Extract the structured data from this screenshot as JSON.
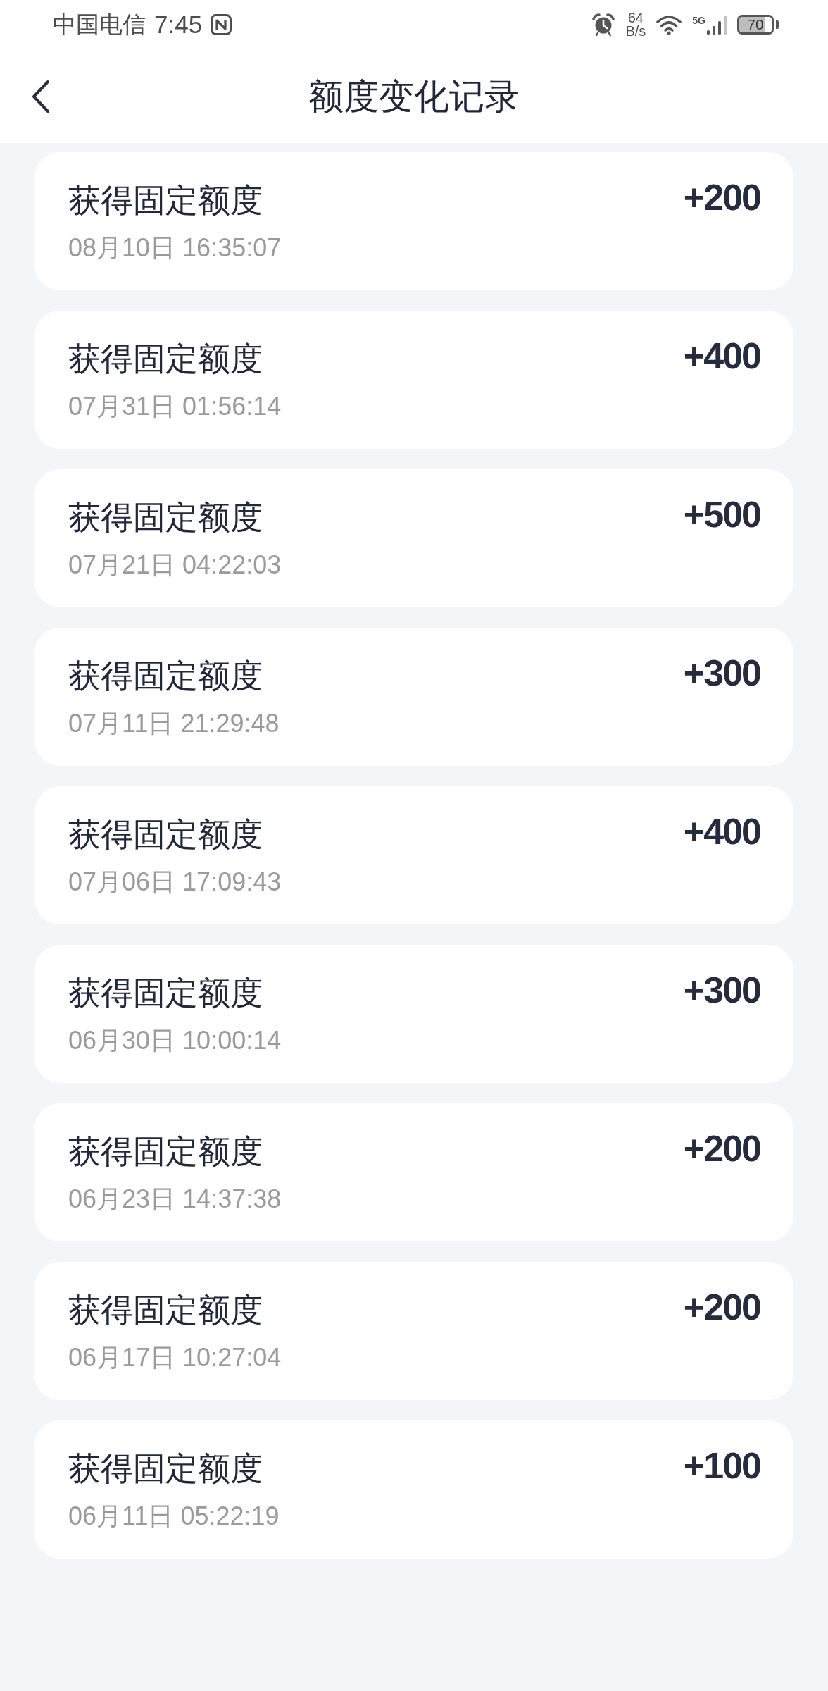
{
  "status_bar": {
    "carrier": "中国电信",
    "time": "7:45",
    "network_speed": {
      "value": "64",
      "unit": "B/s"
    },
    "network_type": "5G",
    "battery": "70"
  },
  "header": {
    "title": "额度变化记录"
  },
  "records": [
    {
      "title": "获得固定额度",
      "time": "08月10日 16:35:07",
      "amount": "+200"
    },
    {
      "title": "获得固定额度",
      "time": "07月31日 01:56:14",
      "amount": "+400"
    },
    {
      "title": "获得固定额度",
      "time": "07月21日 04:22:03",
      "amount": "+500"
    },
    {
      "title": "获得固定额度",
      "time": "07月11日 21:29:48",
      "amount": "+300"
    },
    {
      "title": "获得固定额度",
      "time": "07月06日 17:09:43",
      "amount": "+400"
    },
    {
      "title": "获得固定额度",
      "time": "06月30日 10:00:14",
      "amount": "+300"
    },
    {
      "title": "获得固定额度",
      "time": "06月23日 14:37:38",
      "amount": "+200"
    },
    {
      "title": "获得固定额度",
      "time": "06月17日 10:27:04",
      "amount": "+200"
    },
    {
      "title": "获得固定额度",
      "time": "06月11日 05:22:19",
      "amount": "+100"
    }
  ]
}
